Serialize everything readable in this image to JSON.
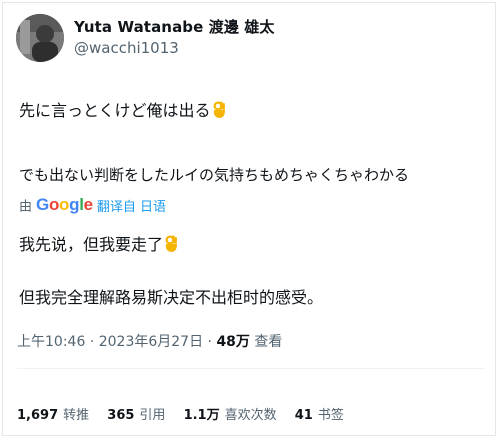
{
  "user": {
    "display_name": "Yuta Watanabe 渡邊 雄太",
    "handle": "@wacchi1013"
  },
  "tweet": {
    "line1": "先に言っとくけど俺は出る",
    "line2": "でも出ない判断をしたルイの気持ちもめちゃくちゃわかる",
    "emoji": "ok-hand"
  },
  "translation": {
    "by": "由",
    "provider": "Google",
    "link_label": "翻译自 日语",
    "line1": "我先说，但我要走了",
    "line2": "但我完全理解路易斯决定不出柜时的感受。"
  },
  "meta": {
    "time": "上午10:46",
    "separator": "·",
    "date": "2023年6月27日",
    "views_count": "48万",
    "views_label": "查看"
  },
  "stats": [
    {
      "count": "1,697",
      "label": "转推"
    },
    {
      "count": "365",
      "label": "引用"
    },
    {
      "count": "1.1万",
      "label": "喜欢次数"
    },
    {
      "count": "41",
      "label": "书签"
    }
  ],
  "colors": {
    "text": "#0f1419",
    "muted": "#536471",
    "link": "#1d9bf0",
    "google_blue": "#4285f4",
    "google_red": "#ea4335",
    "google_yellow": "#fbbc05",
    "google_green": "#34a853",
    "emoji": "#f4b400"
  }
}
